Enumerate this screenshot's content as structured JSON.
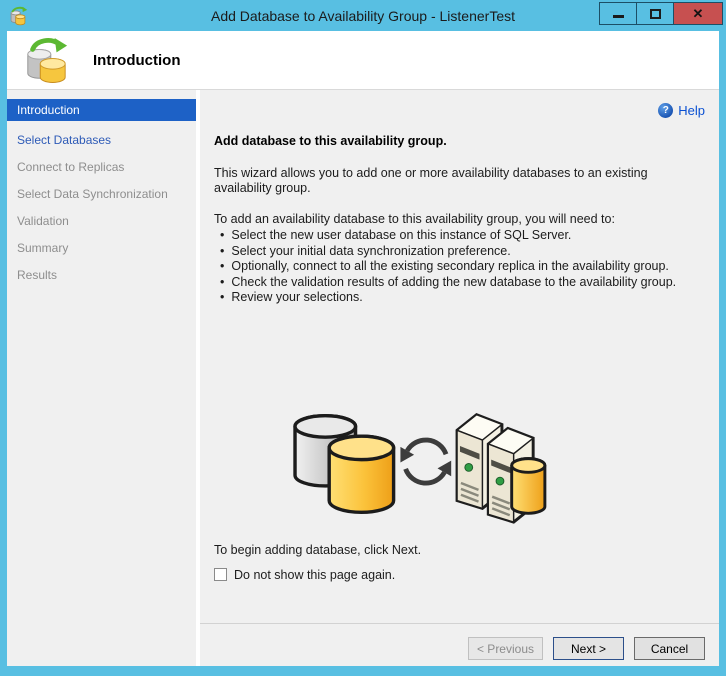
{
  "window": {
    "title": "Add Database to Availability Group - ListenerTest",
    "icons": {
      "close_glyph": "✕"
    }
  },
  "header": {
    "title": "Introduction"
  },
  "sidebar": {
    "items": [
      {
        "label": "Introduction",
        "state": "selected"
      },
      {
        "label": "Select Databases",
        "state": "link"
      },
      {
        "label": "Connect to Replicas",
        "state": "disabled"
      },
      {
        "label": "Select Data Synchronization",
        "state": "disabled"
      },
      {
        "label": "Validation",
        "state": "disabled"
      },
      {
        "label": "Summary",
        "state": "disabled"
      },
      {
        "label": "Results",
        "state": "disabled"
      }
    ]
  },
  "main": {
    "help": {
      "label": "Help",
      "icon_glyph": "?"
    },
    "heading": "Add database to this availability group.",
    "intro": "This wizard allows you to add one or more availability databases to an existing availability group.",
    "steps_title": "To add an availability database to this availability group, you will need to:",
    "steps": [
      "Select the new user database on this instance of SQL Server.",
      "Select your initial data synchronization preference.",
      "Optionally, connect to all the existing secondary replica in the availability group.",
      "Check the validation results of adding the new database to the availability group.",
      "Review your selections."
    ],
    "begin_text": "To begin adding database, click Next.",
    "checkbox_label": "Do not show this page again.",
    "checkbox_checked": false
  },
  "footer": {
    "previous_label": "< Previous",
    "next_label": "Next >",
    "cancel_label": "Cancel"
  },
  "colors": {
    "titlebar_blue": "#58bfe2",
    "close_red": "#c75050",
    "selected_step_bg": "#1d61c6",
    "link_blue": "#2e5bb7",
    "help_blue": "#0a50d2"
  }
}
